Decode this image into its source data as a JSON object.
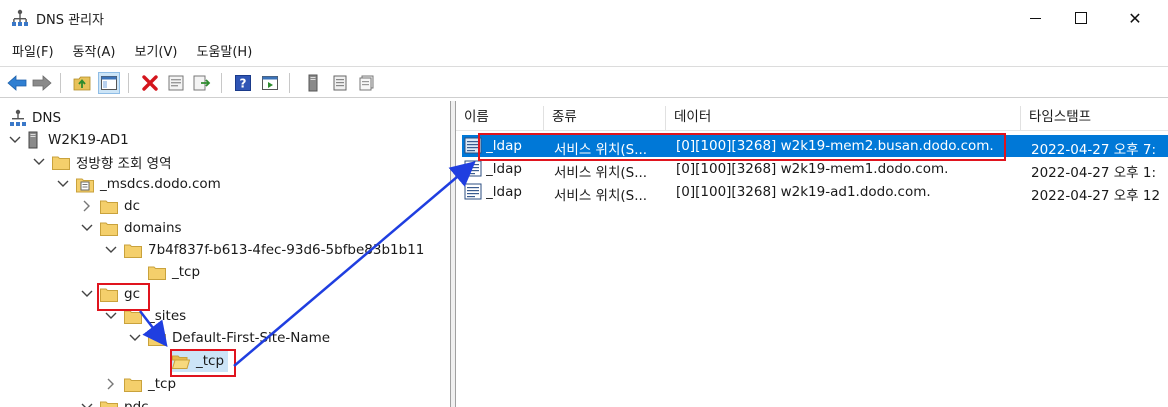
{
  "window": {
    "title": "DNS 관리자",
    "icon": "dns-manager-icon",
    "controls": {
      "minimize": "minimize-icon",
      "maximize": "maximize-icon",
      "close": "✕"
    }
  },
  "menu": [
    "파일(F)",
    "동작(A)",
    "보기(V)",
    "도움말(H)"
  ],
  "toolbar": [
    "back-arrow-icon",
    "forward-arrow-icon",
    "up-folder-icon",
    "show-hide-tree-icon",
    "delete-icon",
    "properties-icon",
    "export-list-icon",
    "help-icon",
    "action-pane-icon",
    "server-icon",
    "zone-list-icon",
    "records-icon"
  ],
  "tree": [
    {
      "label": "DNS",
      "icon": "dns-icon",
      "chevron": "none"
    },
    {
      "label": "W2K19-AD1",
      "icon": "server-icon",
      "chevron": "expanded"
    },
    {
      "label": "정방향 조회 영역",
      "icon": "folder-icon",
      "chevron": "expanded"
    },
    {
      "label": "_msdcs.dodo.com",
      "icon": "zone-icon",
      "chevron": "expanded"
    },
    {
      "label": "dc",
      "icon": "folder-icon",
      "chevron": "collapsed"
    },
    {
      "label": "domains",
      "icon": "folder-icon",
      "chevron": "expanded"
    },
    {
      "label": "7b4f837f-b613-4fec-93d6-5bfbe83b1b11",
      "icon": "folder-icon",
      "chevron": "expanded"
    },
    {
      "label": "_tcp",
      "icon": "folder-icon",
      "chevron": "none"
    },
    {
      "label": "gc",
      "icon": "folder-icon",
      "chevron": "expanded"
    },
    {
      "label": "_sites",
      "icon": "folder-icon",
      "chevron": "expanded"
    },
    {
      "label": "Default-First-Site-Name",
      "icon": "folder-icon",
      "chevron": "expanded"
    },
    {
      "label": "_tcp",
      "icon": "folder-open-icon",
      "chevron": "none"
    },
    {
      "label": "_tcp",
      "icon": "folder-icon",
      "chevron": "collapsed"
    },
    {
      "label": "pdc",
      "icon": "folder-icon",
      "chevron": "expanded"
    }
  ],
  "list": {
    "columns": [
      "이름",
      "종류",
      "데이터",
      "타임스탬프"
    ],
    "rows": [
      {
        "name": "_ldap",
        "type": "서비스 위치(S...",
        "data": "[0][100][3268] w2k19-mem2.busan.dodo.com.",
        "timestamp": "2022-04-27 오후 7:",
        "selected": true
      },
      {
        "name": "_ldap",
        "type": "서비스 위치(S...",
        "data": "[0][100][3268] w2k19-mem1.dodo.com.",
        "timestamp": "2022-04-27 오후 1:",
        "selected": false
      },
      {
        "name": "_ldap",
        "type": "서비스 위치(S...",
        "data": "[0][100][3268] w2k19-ad1.dodo.com.",
        "timestamp": "2022-04-27 오후 12",
        "selected": false
      }
    ]
  },
  "colors": {
    "selection": "#0078d7",
    "highlight_box": "#e0141e",
    "annotation_arrow": "#1f3ee0",
    "folder_fill": "#f4cf6b"
  }
}
